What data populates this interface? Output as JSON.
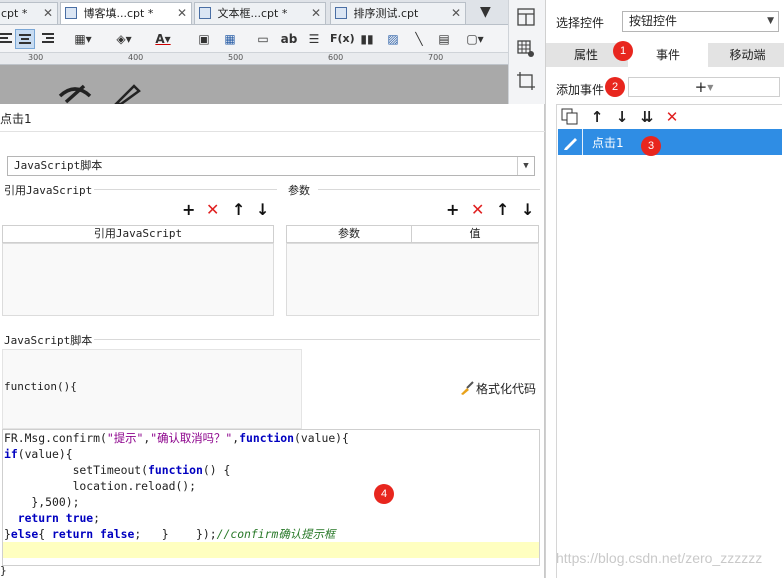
{
  "tabs": [
    {
      "label": "cpt *",
      "close": "✕"
    },
    {
      "label": "博客填...cpt *",
      "close": "✕"
    },
    {
      "label": "文本框...cpt *",
      "close": "✕"
    },
    {
      "label": "排序测试.cpt",
      "close": "✕"
    }
  ],
  "ruler_ticks": [
    "300",
    "400",
    "500",
    "600",
    "700"
  ],
  "toolbar": {
    "fx": "F(x)",
    "ab": "ab"
  },
  "dialog": {
    "event_name": "点击1",
    "script_type": "JavaScript脚本",
    "ref_js_section": "引用JavaScript",
    "ref_js_column": "引用JavaScript",
    "params_section": "参数",
    "params_columns": [
      "参数",
      "值"
    ],
    "js_script_section": "JavaScript脚本",
    "function_signature": "function(){",
    "format_code_label": "格式化代码",
    "code_lines": [
      [
        {
          "t": "FR.Msg.confirm(",
          "c": ""
        },
        {
          "t": "\"提示\"",
          "c": "str"
        },
        {
          "t": ",",
          "c": ""
        },
        {
          "t": "\"确认取消吗？\"",
          "c": "str"
        },
        {
          "t": ",",
          "c": ""
        },
        {
          "t": "function",
          "c": "kw"
        },
        {
          "t": "(value){",
          "c": ""
        }
      ],
      [
        {
          "t": "if",
          "c": "kw"
        },
        {
          "t": "(value){",
          "c": ""
        }
      ],
      [
        {
          "t": "          setTimeout(",
          "c": ""
        },
        {
          "t": "function",
          "c": "kw"
        },
        {
          "t": "() {",
          "c": ""
        }
      ],
      [
        {
          "t": "          location.reload();",
          "c": ""
        }
      ],
      [
        {
          "t": "    },500);",
          "c": ""
        }
      ],
      [
        {
          "t": "  ",
          "c": ""
        },
        {
          "t": "return",
          "c": "kw"
        },
        {
          "t": " ",
          "c": ""
        },
        {
          "t": "true",
          "c": "kw"
        },
        {
          "t": ";",
          "c": ""
        }
      ],
      [
        {
          "t": "}",
          "c": ""
        },
        {
          "t": "else",
          "c": "kw"
        },
        {
          "t": "{ ",
          "c": ""
        },
        {
          "t": "return",
          "c": "kw"
        },
        {
          "t": " ",
          "c": ""
        },
        {
          "t": "false",
          "c": "kw"
        },
        {
          "t": ";   }    });",
          "c": ""
        },
        {
          "t": "//confirm确认提示框",
          "c": "cmt"
        }
      ]
    ],
    "closing_brace": "}"
  },
  "right_panel": {
    "select_label": "选择控件",
    "select_value": "按钮控件",
    "tabs": [
      "属性",
      "事件",
      "移动端"
    ],
    "add_event_label": "添加事件",
    "event_item": "点击1"
  },
  "badges": [
    "1",
    "2",
    "3",
    "4"
  ],
  "watermark": "https://blog.csdn.net/zero_zzzzzz",
  "colors": {
    "selected_row": "#2f8de4",
    "badge": "#e8261e",
    "keyword": "#0000c0",
    "string": "#8b008b",
    "comment": "#2a7a2a",
    "highlight_line": "#ffffc0"
  }
}
